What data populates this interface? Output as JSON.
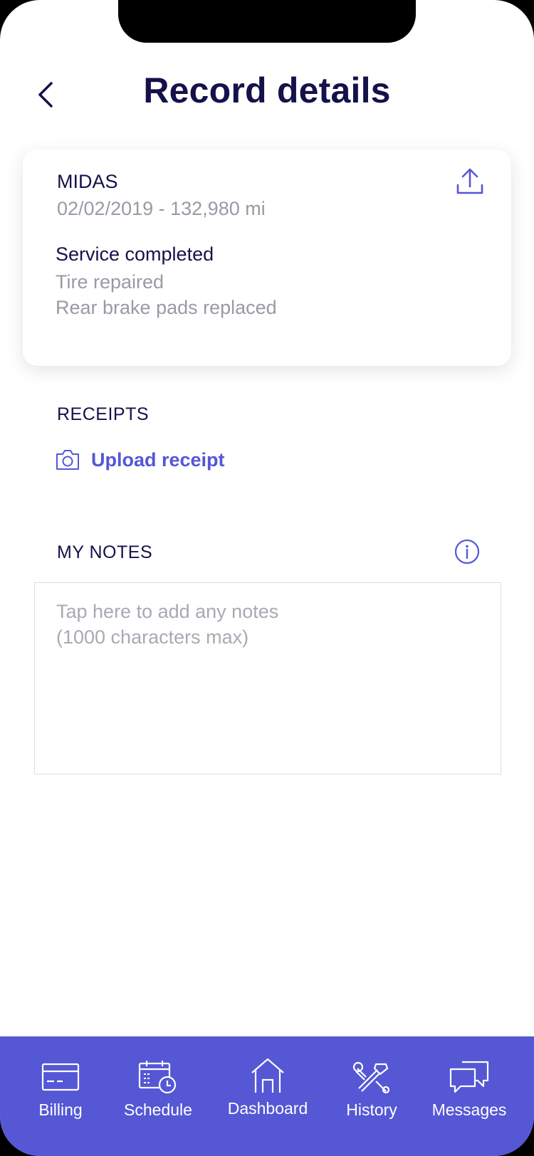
{
  "header": {
    "title": "Record details",
    "back_icon": "chevron-left-icon"
  },
  "record": {
    "shop": "MIDAS",
    "meta": "02/02/2019 - 132,980 mi",
    "service_heading": "Service completed",
    "services": [
      "Tire repaired",
      "Rear brake pads replaced"
    ],
    "share_icon": "share-upload-icon"
  },
  "receipts": {
    "heading": "RECEIPTS",
    "upload_label": "Upload receipt",
    "icon": "camera-icon"
  },
  "notes": {
    "heading": "MY NOTES",
    "placeholder": "Tap here to add any notes\n(1000 characters max)",
    "value": "",
    "info_icon": "info-icon"
  },
  "tabbar": {
    "items": [
      {
        "label": "Billing",
        "icon": "credit-card-icon"
      },
      {
        "label": "Schedule",
        "icon": "calendar-clock-icon"
      },
      {
        "label": "Dashboard",
        "icon": "garage-icon"
      },
      {
        "label": "History",
        "icon": "wrench-hammer-icon"
      },
      {
        "label": "Messages",
        "icon": "chat-bubbles-icon"
      }
    ]
  },
  "colors": {
    "primary": "#5557d5",
    "text_dark": "#14124a",
    "text_muted": "#9a9aa6"
  }
}
